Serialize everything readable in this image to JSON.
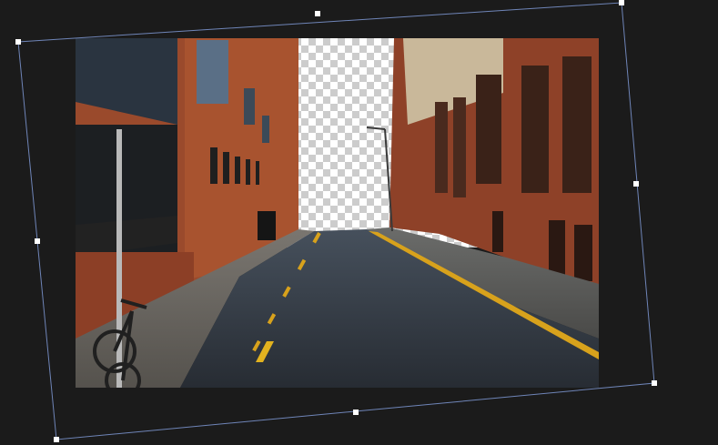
{
  "editor": {
    "tool": "free-transform",
    "layer_image": "street-photo",
    "transparent_region": "sky-removed",
    "colors": {
      "workspace": "#1b1b1b",
      "frame_line": "#6f85b8",
      "handle_fill": "#ffffff",
      "checker_light": "#ffffff",
      "checker_dark": "#cccccc"
    }
  }
}
